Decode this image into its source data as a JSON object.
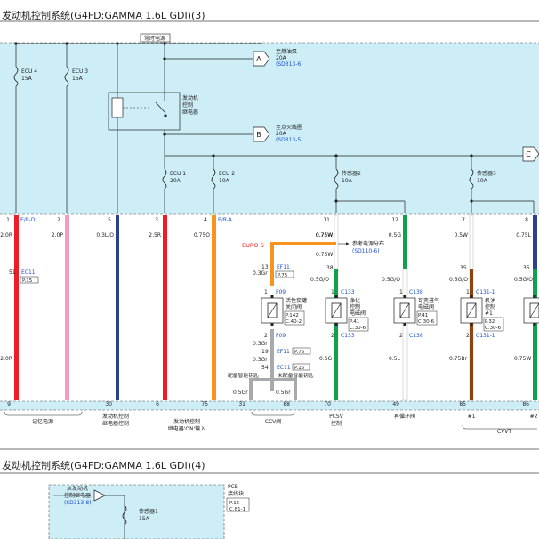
{
  "page": {
    "title_top": "发动机控制系统(G4FD:GAMMA 1.6L GDI)(3)",
    "title_bottom": "发动机控制系统(G4FD:GAMMA 1.6L GDI)(4)"
  },
  "diagram": {
    "hot_label": "常时电源",
    "relay_label": [
      "发动机",
      "控制",
      "继电器"
    ],
    "refs": {
      "A": {
        "letter": "A",
        "l1": "至燃油泵",
        "l2": "20A",
        "l3": "(SD313-6)"
      },
      "B": {
        "letter": "B",
        "l1": "至点火线圈",
        "l2": "20A",
        "l3": "(SD313-5)"
      },
      "C": {
        "letter": "C"
      }
    },
    "fuses": [
      {
        "id": "ecu4",
        "l1": "ECU 4",
        "l2": "15A"
      },
      {
        "id": "ecu3",
        "l1": "ECU 3",
        "l2": "15A"
      },
      {
        "id": "ecu1",
        "l1": "ECU 1",
        "l2": "20A"
      },
      {
        "id": "ecu2",
        "l1": "ECU 2",
        "l2": "10A"
      },
      {
        "id": "s2",
        "l1": "传感器2",
        "l2": "10A"
      },
      {
        "id": "s3",
        "l1": "传感器3",
        "l2": "10A"
      }
    ],
    "top_pins": [
      {
        "id": "p1",
        "pin": "1",
        "code": "E/R-D",
        "wire": "2.0R"
      },
      {
        "id": "p2",
        "pin": "2",
        "code": "",
        "wire": "2.0P"
      },
      {
        "id": "p5",
        "pin": "5",
        "code": "",
        "wire": "0.3L/O"
      },
      {
        "id": "p3",
        "pin": "3",
        "code": "",
        "wire": "2.5R"
      },
      {
        "id": "p4",
        "pin": "4",
        "code": "E/R-A",
        "wire": "0.75O"
      },
      {
        "id": "p11",
        "pin": "11",
        "code": "",
        "wire": "0.75W"
      },
      {
        "id": "p12",
        "pin": "12",
        "code": "",
        "wire": "0.5G"
      },
      {
        "id": "p7",
        "pin": "7",
        "code": "",
        "wire": "0.5W"
      },
      {
        "id": "p8",
        "pin": "8",
        "code": "",
        "wire": "0.75L"
      }
    ],
    "bottom_pins": [
      {
        "id": "b9",
        "pin": "9",
        "wire": "2.0R"
      },
      {
        "id": "b30",
        "pin": "30"
      },
      {
        "id": "b6",
        "pin": "6"
      },
      {
        "id": "b75",
        "pin": "75"
      },
      {
        "id": "b31",
        "pin": "31"
      },
      {
        "id": "b88",
        "pin": "88"
      },
      {
        "id": "b70",
        "pin": "70"
      },
      {
        "id": "b49",
        "pin": "49"
      },
      {
        "id": "b85",
        "pin": "85"
      },
      {
        "id": "b86",
        "pin": "86"
      }
    ],
    "ec11_top": {
      "code": "EC11",
      "pin": "51",
      "page": "P.15"
    },
    "euro6": "EURO 6",
    "supply_ref": {
      "l1": "参考电源分布",
      "l2": "(SD110-6)"
    },
    "misc_wires": {
      "w075w_a": "0.75W",
      "w075w_b": "0.75W",
      "w05go_a": "0.5G/O",
      "w05go_b": "0.5G/O",
      "w05go_c": "0.5G/O",
      "w05go_d": "0.5G/O",
      "w05g_l": "0.5G",
      "w05l": "0.5L",
      "w075br": "0.75Br",
      "w075w_r": "0.75W",
      "w03gr_a": "0.3Gr",
      "w03gr_b": "0.3Gr",
      "w03gr_c": "0.3Gr",
      "w05gr_a": "0.5Gr",
      "w05gr_b": "0.5Gr"
    },
    "ef11": {
      "code": "EF11",
      "pin_a": "13",
      "pin_b": "19",
      "page": "P.75"
    },
    "ec11_b": {
      "code": "EC11",
      "pin": "54",
      "page": "P.15"
    },
    "f09": {
      "code": "F09",
      "pin_top": "1",
      "pin_bot": "2"
    },
    "c133_top": {
      "code": "C133",
      "pin_top": "38",
      "pin1": "1",
      "pin2": "2"
    },
    "c138": {
      "code": "C138",
      "pin1": "1",
      "pin2": "2"
    },
    "c131": {
      "code": "C131-1",
      "pin_top": "35",
      "pin1": "1",
      "pin2": "2"
    },
    "components": {
      "purge": {
        "l1": "活性炭罐",
        "l2": "关闭阀",
        "p1": "P.142",
        "p2": "C.40-2"
      },
      "pcsv": {
        "l1": "净化",
        "l2": "控制",
        "l3": "电磁阀",
        "p1": "P.41",
        "p2": "C.30-6"
      },
      "egr": {
        "l1": "可变进气",
        "l2": "电磁阀",
        "p1": "P.41",
        "p2": "C.30-6"
      },
      "ocv": {
        "l1": "机油",
        "l2": "控制",
        "l3": "#1",
        "p1": "P.32",
        "p2": "C.30-6"
      }
    },
    "smart_a": "配备智能钥匙",
    "smart_b": "未配备智能钥匙",
    "bottom_labels": {
      "mem": "记忆电源",
      "relay1": "发动机控制",
      "relay2": "继电器控制",
      "relay_on1": "发动机控制",
      "relay_on2": "继电器'ON'输入",
      "ccv": "CCV阀",
      "pcsv1": "PCSV",
      "pcsv2": "控制",
      "vis": "再循环阀",
      "no1": "#1",
      "no2": "#2",
      "cvvt": "CVVT"
    },
    "page4": {
      "from_relay": [
        "从发动机",
        "控制继电器",
        "(SD313-8)"
      ],
      "pcb": [
        "PCB",
        "接线块",
        "P.15",
        "C.81-1"
      ],
      "sensor1": {
        "l1": "传感器1",
        "l2": "15A"
      }
    }
  },
  "colors": {
    "panel": "#cdeef7",
    "red": "#ee1c25",
    "pink": "#f59ac8",
    "navy": "#2e3f8f",
    "orange": "#f7941d",
    "white": "#ffffff",
    "green": "#11a04b",
    "brown": "#8b4513",
    "gray": "#a7a9ac",
    "blue_text": "#1a4fd0"
  }
}
